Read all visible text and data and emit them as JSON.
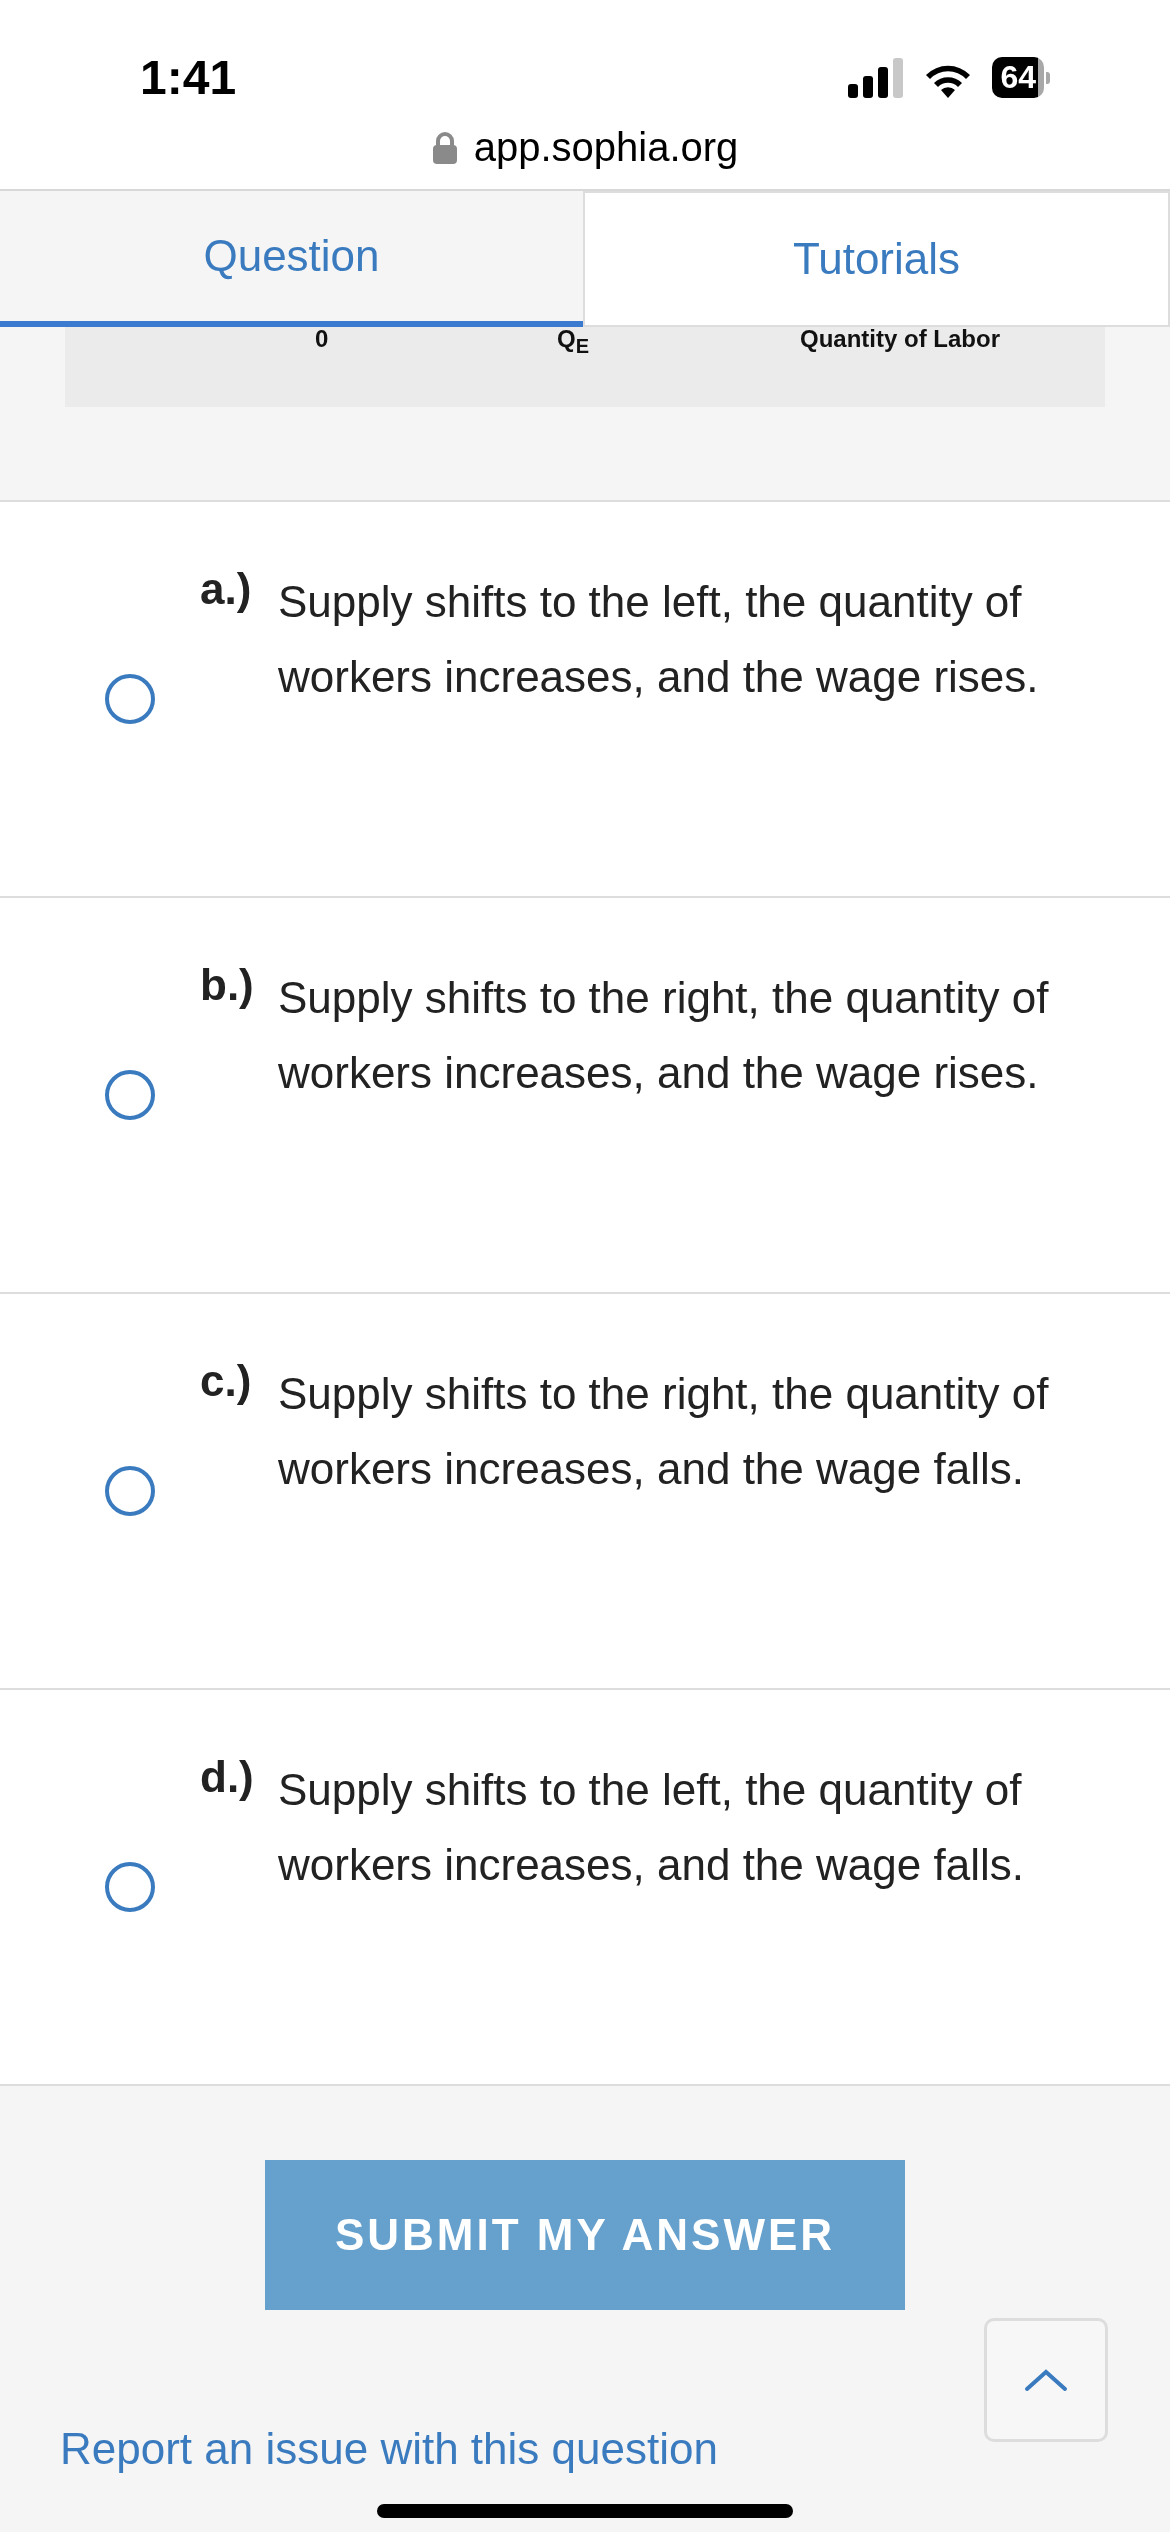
{
  "status_bar": {
    "time": "1:41",
    "battery": "64"
  },
  "address_bar": {
    "url": "app.sophia.org"
  },
  "tabs": [
    {
      "label": "Question",
      "selected": true
    },
    {
      "label": "Tutorials",
      "selected": false
    }
  ],
  "graph_axis": {
    "origin": "0",
    "equilibrium": "Q$_{E}$",
    "xlabel": "Quantity of Labor"
  },
  "options": [
    {
      "letter": "a.)",
      "text": "Supply shifts to the left, the quantity of workers increases, and the wage rises.",
      "selected": false
    },
    {
      "letter": "b.)",
      "text": "Supply shifts to the right, the quantity of workers increases, and the wage rises.",
      "selected": false
    },
    {
      "letter": "c.)",
      "text": "Supply shifts to the right, the quantity of workers increases, and the wage falls.",
      "selected": false
    },
    {
      "letter": "d.)",
      "text": "Supply shifts to the left, the quantity of workers increases, and the wage falls.",
      "selected": false
    }
  ],
  "submit_button": "SUBMIT MY ANSWER",
  "report_link": "Report an issue with this question"
}
